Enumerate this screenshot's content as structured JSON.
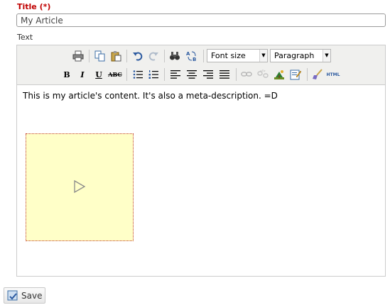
{
  "form": {
    "title_label": "Title (*)",
    "title_value": "My Article",
    "text_label": "Text",
    "save_label": "Save"
  },
  "toolbar": {
    "font_size": "Font size",
    "format": "Paragraph",
    "row1_icons": [
      "print-icon",
      "copy-icon",
      "paste-icon",
      "undo-icon",
      "redo-icon",
      "find-icon",
      "replace-icon"
    ],
    "row2_icons": [
      "bold",
      "italic",
      "underline",
      "strikethrough",
      "unordered-list-icon",
      "ordered-list-icon",
      "align-left-icon",
      "align-center-icon",
      "align-right-icon",
      "align-justify-icon",
      "link-icon",
      "unlink-icon",
      "image-icon",
      "edit-icon",
      "cleanup-icon",
      "html-icon"
    ],
    "bold": "B",
    "italic": "I",
    "underline": "U",
    "strikethrough": "ABC",
    "html": "HTML"
  },
  "editor": {
    "content": "This is my article's content. It's also a meta-description.  =D"
  },
  "colors": {
    "title_label": "#c00000",
    "media_placeholder_bg": "#ffffc8",
    "media_placeholder_border": "#c0392b"
  }
}
